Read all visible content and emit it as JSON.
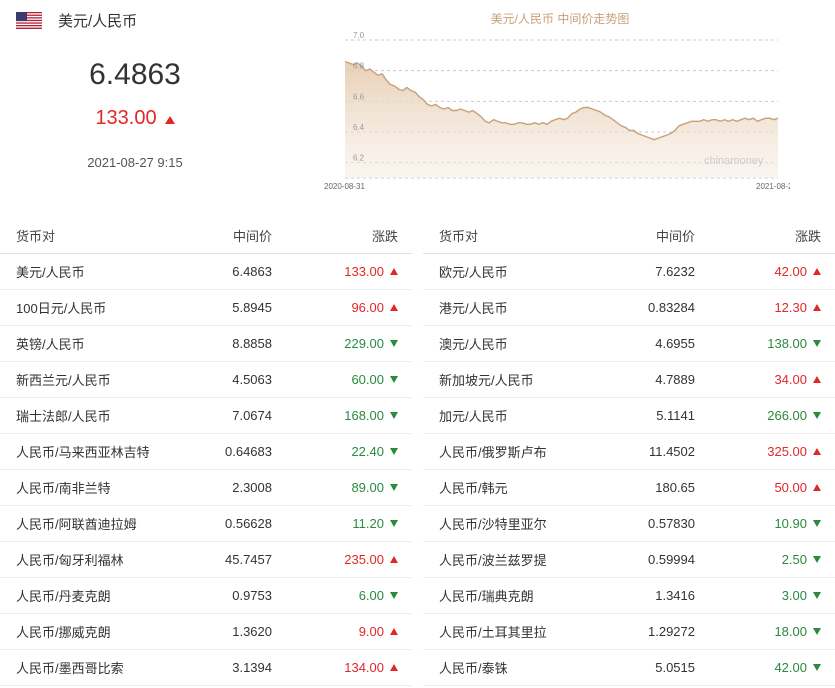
{
  "header": {
    "pair_name": "美元/人民币",
    "rate": "6.4863",
    "change": "133.00",
    "change_direction": "up",
    "datetime": "2021-08-27 9:15"
  },
  "colors": {
    "up": "#e02828",
    "down": "#2b8a3e",
    "chart_line": "#c8a07a",
    "chart_fill_top": "#e9d2b9"
  },
  "chart_data": {
    "type": "area",
    "title": "美元/人民币 中间价走势图",
    "watermark": "chinamoney",
    "x_start_label": "2020-08-31",
    "x_end_label": "2021-08-27",
    "y_ticks": [
      "7.0",
      "6.8",
      "6.6",
      "6.4",
      "6.2"
    ],
    "ylim": [
      6.1,
      7.0
    ],
    "grid": true,
    "series": [
      {
        "values": [
          6.86,
          6.85,
          6.84,
          6.85,
          6.83,
          6.8,
          6.81,
          6.79,
          6.77,
          6.78,
          6.74,
          6.71,
          6.7,
          6.68,
          6.67,
          6.69,
          6.67,
          6.66,
          6.63,
          6.61,
          6.58,
          6.57,
          6.58,
          6.56,
          6.55,
          6.56,
          6.54,
          6.54,
          6.55,
          6.54,
          6.53,
          6.54,
          6.52,
          6.5,
          6.47,
          6.46,
          6.48,
          6.47,
          6.46,
          6.46,
          6.45,
          6.45,
          6.46,
          6.46,
          6.45,
          6.45,
          6.46,
          6.45,
          6.46,
          6.45,
          6.47,
          6.48,
          6.49,
          6.48,
          6.49,
          6.52,
          6.53,
          6.55,
          6.56,
          6.56,
          6.55,
          6.54,
          6.53,
          6.51,
          6.5,
          6.48,
          6.46,
          6.44,
          6.43,
          6.41,
          6.41,
          6.39,
          6.38,
          6.37,
          6.36,
          6.35,
          6.36,
          6.37,
          6.38,
          6.39,
          6.41,
          6.44,
          6.45,
          6.46,
          6.47,
          6.47,
          6.47,
          6.48,
          6.47,
          6.48,
          6.48,
          6.47,
          6.48,
          6.47,
          6.48,
          6.47,
          6.48,
          6.49,
          6.48,
          6.49,
          6.47,
          6.48,
          6.49,
          6.49,
          6.48,
          6.49
        ]
      }
    ]
  },
  "table_headers": {
    "pair": "货币对",
    "mid": "中间价",
    "change": "涨跌"
  },
  "left_rows": [
    {
      "name": "美元/人民币",
      "mid": "6.4863",
      "change": "133.00",
      "dir": "up"
    },
    {
      "name": "100日元/人民币",
      "mid": "5.8945",
      "change": "96.00",
      "dir": "up"
    },
    {
      "name": "英镑/人民币",
      "mid": "8.8858",
      "change": "229.00",
      "dir": "down"
    },
    {
      "name": "新西兰元/人民币",
      "mid": "4.5063",
      "change": "60.00",
      "dir": "down"
    },
    {
      "name": "瑞士法郎/人民币",
      "mid": "7.0674",
      "change": "168.00",
      "dir": "down"
    },
    {
      "name": "人民币/马来西亚林吉特",
      "mid": "0.64683",
      "change": "22.40",
      "dir": "down"
    },
    {
      "name": "人民币/南非兰特",
      "mid": "2.3008",
      "change": "89.00",
      "dir": "down"
    },
    {
      "name": "人民币/阿联酋迪拉姆",
      "mid": "0.56628",
      "change": "11.20",
      "dir": "down"
    },
    {
      "name": "人民币/匈牙利福林",
      "mid": "45.7457",
      "change": "235.00",
      "dir": "up"
    },
    {
      "name": "人民币/丹麦克朗",
      "mid": "0.9753",
      "change": "6.00",
      "dir": "down"
    },
    {
      "name": "人民币/挪威克朗",
      "mid": "1.3620",
      "change": "9.00",
      "dir": "up"
    },
    {
      "name": "人民币/墨西哥比索",
      "mid": "3.1394",
      "change": "134.00",
      "dir": "up"
    }
  ],
  "right_rows": [
    {
      "name": "欧元/人民币",
      "mid": "7.6232",
      "change": "42.00",
      "dir": "up"
    },
    {
      "name": "港元/人民币",
      "mid": "0.83284",
      "change": "12.30",
      "dir": "up"
    },
    {
      "name": "澳元/人民币",
      "mid": "4.6955",
      "change": "138.00",
      "dir": "down"
    },
    {
      "name": "新加坡元/人民币",
      "mid": "4.7889",
      "change": "34.00",
      "dir": "up"
    },
    {
      "name": "加元/人民币",
      "mid": "5.1141",
      "change": "266.00",
      "dir": "down"
    },
    {
      "name": "人民币/俄罗斯卢布",
      "mid": "11.4502",
      "change": "325.00",
      "dir": "up"
    },
    {
      "name": "人民币/韩元",
      "mid": "180.65",
      "change": "50.00",
      "dir": "up"
    },
    {
      "name": "人民币/沙特里亚尔",
      "mid": "0.57830",
      "change": "10.90",
      "dir": "down"
    },
    {
      "name": "人民币/波兰兹罗提",
      "mid": "0.59994",
      "change": "2.50",
      "dir": "down"
    },
    {
      "name": "人民币/瑞典克朗",
      "mid": "1.3416",
      "change": "3.00",
      "dir": "down"
    },
    {
      "name": "人民币/土耳其里拉",
      "mid": "1.29272",
      "change": "18.00",
      "dir": "down"
    },
    {
      "name": "人民币/泰铢",
      "mid": "5.0515",
      "change": "42.00",
      "dir": "down"
    }
  ]
}
